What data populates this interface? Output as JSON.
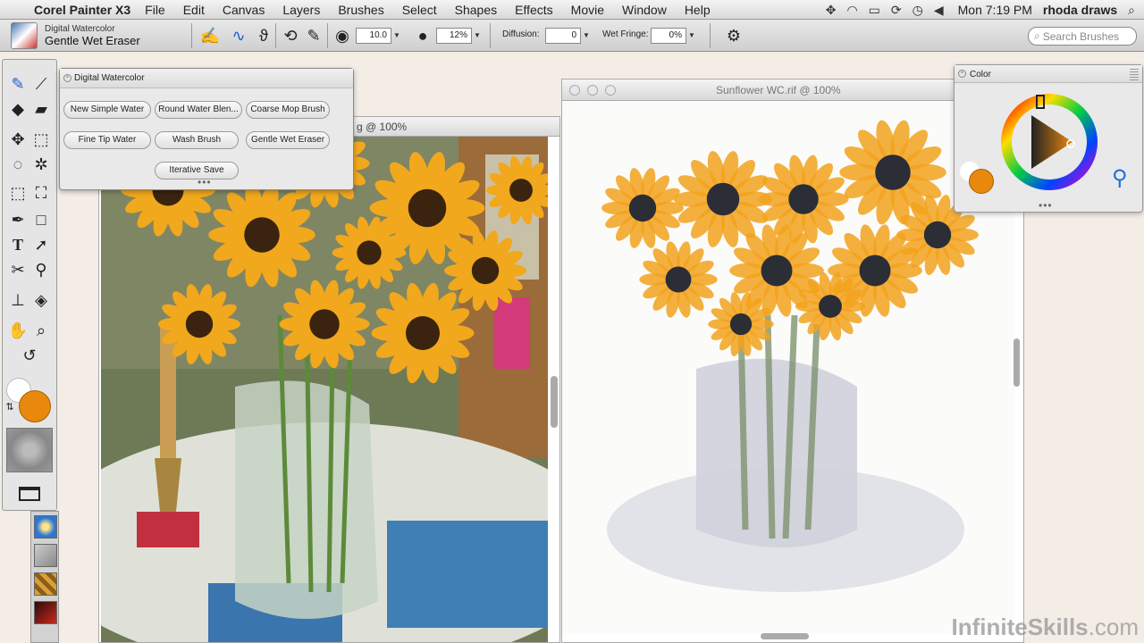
{
  "menubar": {
    "app_name": "Corel Painter X3",
    "items": [
      "File",
      "Edit",
      "Canvas",
      "Layers",
      "Brushes",
      "Select",
      "Shapes",
      "Effects",
      "Movie",
      "Window",
      "Help"
    ],
    "clock": "Mon 7:19 PM",
    "user": "rhoda draws"
  },
  "propbar": {
    "brush_category": "Digital Watercolor",
    "brush_variant": "Gentle Wet Eraser",
    "size_value": "10.0",
    "opacity_value": "12%",
    "diffusion_label": "Diffusion:",
    "diffusion_value": "0",
    "wet_fringe_label": "Wet Fringe:",
    "wet_fringe_value": "0%",
    "search_placeholder": "Search Brushes"
  },
  "palette": {
    "title": "Digital Watercolor",
    "buttons": [
      "New Simple Water",
      "Round Water Blen...",
      "Coarse Mop Brush",
      "Fine Tip Water",
      "Wash Brush",
      "Gentle Wet Eraser",
      "Iterative Save"
    ]
  },
  "ref_window": {
    "title": "g @ 100%"
  },
  "paint_window": {
    "title": "Sunflower WC.rif @ 100%"
  },
  "color_panel": {
    "title": "Color"
  },
  "colors": {
    "main": "#e8890d",
    "additional": "#ffffff",
    "accent": "#1e5fd1"
  },
  "watermark": {
    "brand": "InfiniteSkills",
    "suffix": ".com"
  }
}
